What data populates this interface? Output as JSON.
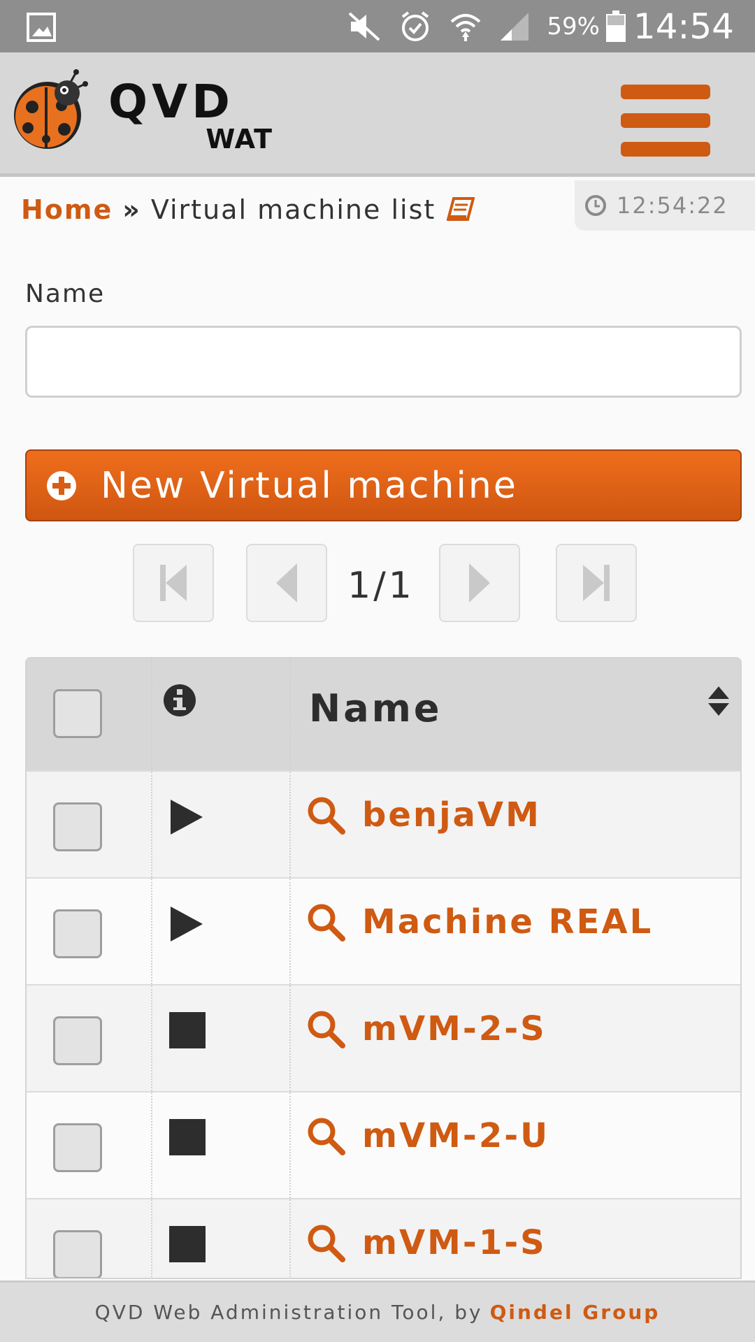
{
  "status_bar": {
    "battery_percent": "59%",
    "clock": "14:54",
    "icons": [
      "gallery-icon",
      "mute-icon",
      "alarm-icon",
      "wifi-icon",
      "signal-icon",
      "battery-icon"
    ]
  },
  "header": {
    "logo_text": "QVD",
    "logo_subtext": "WAT",
    "menu_icon": "hamburger-menu-icon",
    "accent_color": "#cf5a12"
  },
  "breadcrumb": {
    "home": "Home",
    "separator": "»",
    "current": "Virtual machine list"
  },
  "server_clock": "12:54:22",
  "filter": {
    "label": "Name",
    "value": "",
    "placeholder": ""
  },
  "new_button": {
    "label": "New Virtual machine"
  },
  "pagination": {
    "text": "1/1"
  },
  "table": {
    "header_name": "Name",
    "rows": [
      {
        "state": "running",
        "name": "benjaVM"
      },
      {
        "state": "running",
        "name": "Machine REAL"
      },
      {
        "state": "stopped",
        "name": "mVM-2-S"
      },
      {
        "state": "stopped",
        "name": "mVM-2-U"
      },
      {
        "state": "stopped",
        "name": "mVM-1-S"
      }
    ]
  },
  "footer": {
    "text": "QVD Web Administration Tool, by",
    "brand": "Qindel Group"
  }
}
